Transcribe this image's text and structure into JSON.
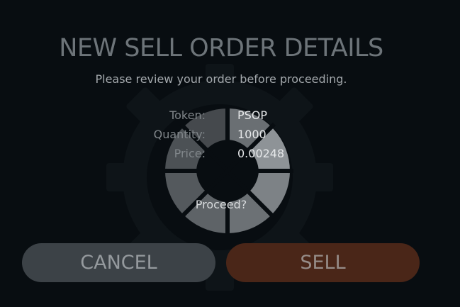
{
  "dialog": {
    "title": "NEW SELL ORDER DETAILS",
    "subtitle": "Please review your order before proceeding.",
    "details": [
      {
        "label": "Token:",
        "value": "PSOP"
      },
      {
        "label": "Quantity:",
        "value": "1000"
      },
      {
        "label": "Price:",
        "value": "0.00248"
      }
    ],
    "prompt": "Proceed?",
    "cancel_label": "CANCEL",
    "sell_label": "SELL"
  },
  "colors": {
    "background": "#080d11",
    "cancel_button": "#3c4247",
    "sell_button": "#4a2618"
  }
}
